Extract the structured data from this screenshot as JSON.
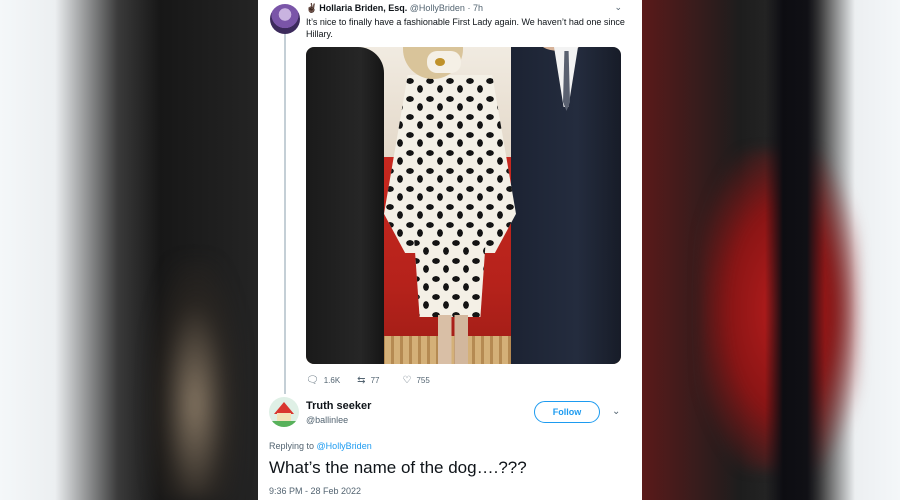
{
  "tweet": {
    "emoji": "✌🏿",
    "author_name": "Hollaria Briden, Esq.",
    "author_handle": "@HollyBriden",
    "age": "7h",
    "text": "It’s nice to finally have a fashionable First Lady again. We haven’t had one since Hillary.",
    "stats": {
      "replies": "1.6K",
      "retweets": "77",
      "likes": "755"
    }
  },
  "reply": {
    "author_name": "Truth seeker",
    "author_handle": "@ballinlee",
    "follow_label": "Follow",
    "replying_prefix": "Replying to",
    "replying_to": "@HollyBriden",
    "text": "What’s the name of the dog….???",
    "timestamp": "9:36 PM - 28 Feb 2022"
  },
  "colors": {
    "accent": "#1d9bf0",
    "text": "#0f1419",
    "muted": "#536471"
  }
}
